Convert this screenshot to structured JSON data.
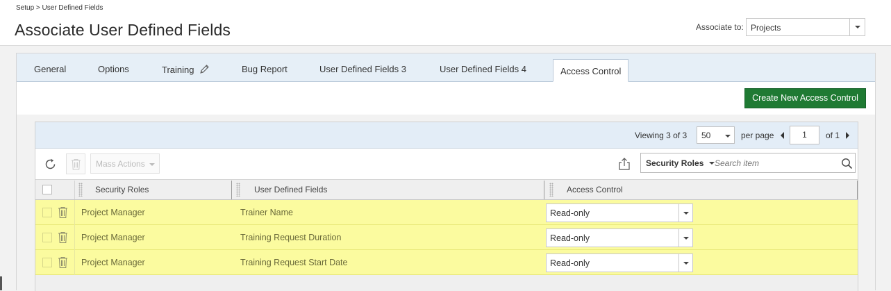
{
  "header": {
    "breadcrumb": "Setup > User Defined Fields",
    "title": "Associate User Defined Fields",
    "associate_label": "Associate to:",
    "associate_value": "Projects"
  },
  "tabs": [
    {
      "label": "General"
    },
    {
      "label": "Options"
    },
    {
      "label": "Training"
    },
    {
      "label": "Bug Report"
    },
    {
      "label": "User Defined Fields 3"
    },
    {
      "label": "User Defined Fields 4"
    },
    {
      "label": "Access Control",
      "active": true
    }
  ],
  "actions": {
    "create_label": "Create New Access Control"
  },
  "pager": {
    "viewing": "Viewing 3 of 3",
    "per_page_value": "50",
    "per_page_label": "per page",
    "page": "1",
    "of_pages": "of 1"
  },
  "toolbar": {
    "mass_actions_label": "Mass Actions",
    "search_field": "Security Roles",
    "search_placeholder": "Search item"
  },
  "table": {
    "columns": [
      "Security Roles",
      "User Defined Fields",
      "Access Control"
    ],
    "rows": [
      {
        "role": "Project Manager",
        "field": "Trainer Name",
        "access": "Read-only"
      },
      {
        "role": "Project Manager",
        "field": "Training Request Duration",
        "access": "Read-only"
      },
      {
        "role": "Project Manager",
        "field": "Training Request Start Date",
        "access": "Read-only"
      }
    ]
  },
  "colors": {
    "accent_green": "#1f7a33",
    "row_highlight": "#fbfb9f",
    "tabbar_bg": "#e6eff7"
  },
  "icons": [
    "pencil-icon",
    "refresh-icon",
    "trash-icon",
    "export-icon",
    "search-icon",
    "chevron-down-icon"
  ]
}
